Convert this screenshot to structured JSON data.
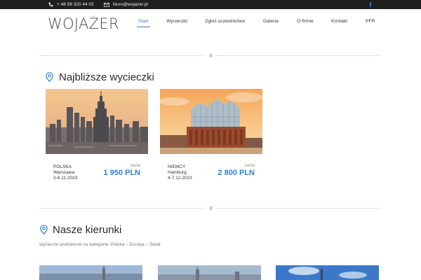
{
  "topbar": {
    "phone": "+ 48 58 320 44 02",
    "email": "biuro@wojazer.pl",
    "icons": {
      "phone": "phone-icon",
      "email": "envelope-icon",
      "social": "facebook-icon"
    }
  },
  "header": {
    "logo": "WOJAŻER",
    "nav": [
      {
        "label": "Start",
        "active": true
      },
      {
        "label": "Wycieczki"
      },
      {
        "label": "Zgłoś uczestnictwo"
      },
      {
        "label": "Galeria"
      },
      {
        "label": "O firmie"
      },
      {
        "label": "Kontakt"
      },
      {
        "label": "PFR"
      }
    ]
  },
  "trips": {
    "title": "Najbliższe wycieczki",
    "icon": "location-pin-icon",
    "cards": [
      {
        "country": "POLSKA",
        "city": "Warszawa",
        "dates": "3-6.11.2023",
        "price_label": "cena",
        "price": "1 950 PLN",
        "image": "warsaw-skyline"
      },
      {
        "country": "NIEMCY",
        "city": "Hamburg",
        "dates": "4-7.12.2023",
        "price_label": "cena",
        "price": "2 800 PLN",
        "image": "hamburg-elbphilharmonie"
      }
    ]
  },
  "directions": {
    "title": "Nasze kierunki",
    "icon": "location-pin-icon",
    "description": "wycieczki podzielone na kategorie: Polska – Europa – Świat"
  },
  "colors": {
    "accent": "#2f7fd0",
    "topbar": "#1f1f1f",
    "divider": "#e3e3e3"
  }
}
